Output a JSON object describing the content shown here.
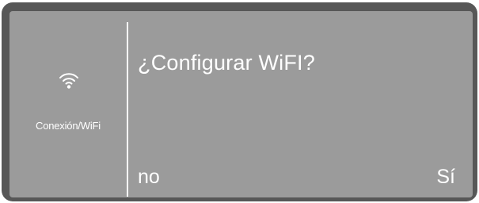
{
  "side_panel": {
    "icon": "wifi-icon",
    "label": "Conexión/WiFi"
  },
  "dialog": {
    "prompt": "¿Configurar WiFI?",
    "no_label": "no",
    "yes_label": "Sí"
  },
  "colors": {
    "bezel": "#575757",
    "screen": "#9b9b9b",
    "text": "#ffffff"
  }
}
